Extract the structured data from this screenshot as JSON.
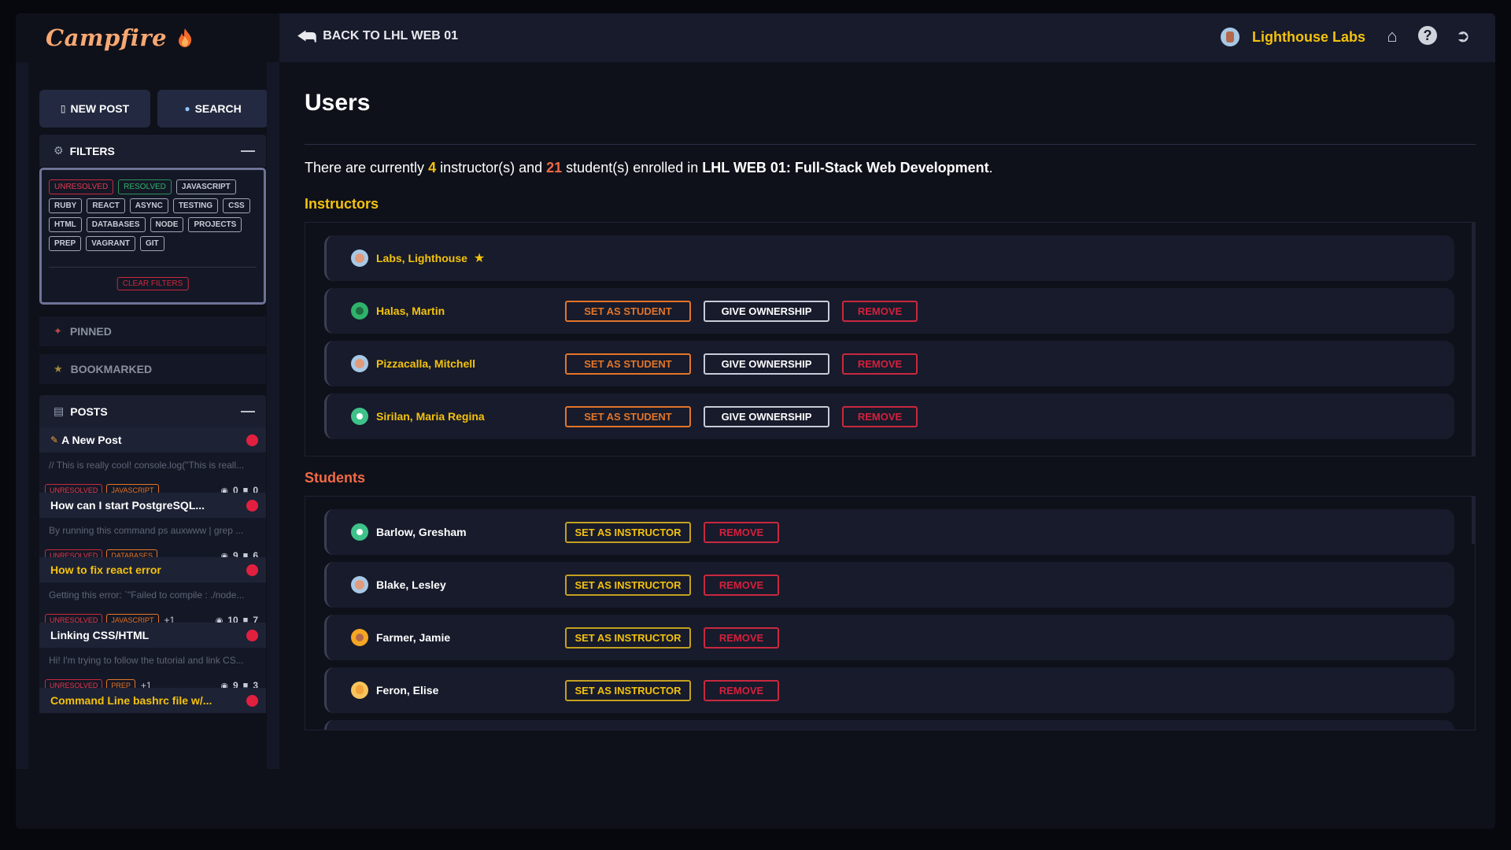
{
  "app": {
    "name": "Campfire"
  },
  "sidebar": {
    "new_post_label": "NEW POST",
    "search_label": "SEARCH",
    "filters_title": "FILTERS",
    "filter_tags": [
      {
        "label": "UNRESOLVED",
        "style": "red"
      },
      {
        "label": "RESOLVED",
        "style": "green"
      },
      {
        "label": "JAVASCRIPT",
        "style": "plain"
      },
      {
        "label": "RUBY",
        "style": "plain"
      },
      {
        "label": "REACT",
        "style": "plain"
      },
      {
        "label": "ASYNC",
        "style": "plain"
      },
      {
        "label": "TESTING",
        "style": "plain"
      },
      {
        "label": "CSS",
        "style": "plain"
      },
      {
        "label": "HTML",
        "style": "plain"
      },
      {
        "label": "DATABASES",
        "style": "plain"
      },
      {
        "label": "NODE",
        "style": "plain"
      },
      {
        "label": "PROJECTS",
        "style": "plain"
      },
      {
        "label": "PREP",
        "style": "plain"
      },
      {
        "label": "VAGRANT",
        "style": "plain"
      },
      {
        "label": "GIT",
        "style": "plain"
      }
    ],
    "clear_filters_label": "CLEAR FILTERS",
    "pinned_label": "PINNED",
    "bookmarked_label": "BOOKMARKED",
    "posts_title": "POSTS",
    "posts": [
      {
        "title": "A New Post",
        "title_color": "white",
        "preview": "// This is really cool! console.log(\"This is reall...",
        "tags": [
          "UNRESOLVED",
          "JAVASCRIPT"
        ],
        "more": "",
        "views": "0",
        "comments": "0",
        "pencil": true
      },
      {
        "title": "How can I start PostgreSQL...",
        "title_color": "white",
        "preview": "By running this command ps auxwww | grep ...",
        "tags": [
          "UNRESOLVED",
          "DATABASES"
        ],
        "more": "",
        "views": "9",
        "comments": "6",
        "pencil": false
      },
      {
        "title": "How to fix react error",
        "title_color": "yellow",
        "preview": "Getting this error: `\"Failed to compile : ./node...",
        "tags": [
          "UNRESOLVED",
          "JAVASCRIPT"
        ],
        "more": "+1",
        "views": "10",
        "comments": "7",
        "pencil": false
      },
      {
        "title": "Linking CSS/HTML",
        "title_color": "white",
        "preview": "Hi! I'm trying to follow the tutorial and link CS...",
        "tags": [
          "UNRESOLVED",
          "PREP"
        ],
        "more": "+1",
        "views": "9",
        "comments": "3",
        "pencil": false
      },
      {
        "title": "Command Line bashrc file w/...",
        "title_color": "yellow",
        "preview": "",
        "tags": [],
        "more": "",
        "views": "",
        "comments": "",
        "pencil": false
      }
    ]
  },
  "topbar": {
    "back_label": "BACK TO LHL WEB 01",
    "org_name": "Lighthouse Labs",
    "icons": [
      "home-icon",
      "help-icon",
      "logout-icon"
    ]
  },
  "main": {
    "title": "Users",
    "summary": {
      "pre": "There are currently ",
      "instructor_count": "4",
      "mid1": " instructor(s) and ",
      "student_count": "21",
      "mid2": " student(s) enrolled in ",
      "course": "LHL WEB 01: Full-Stack Web Development",
      "end": "."
    },
    "instructors_title": "Instructors",
    "students_title": "Students",
    "instructors": [
      {
        "name": "Labs, Lighthouse",
        "owner": true,
        "avatar": "blue"
      },
      {
        "name": "Halas, Martin",
        "owner": false,
        "avatar": "green"
      },
      {
        "name": "Pizzacalla, Mitchell",
        "owner": false,
        "avatar": "blue"
      },
      {
        "name": "Sirilan, Maria Regina",
        "owner": false,
        "avatar": "teal"
      }
    ],
    "students": [
      {
        "name": "Barlow, Gresham",
        "avatar": "teal"
      },
      {
        "name": "Blake, Lesley",
        "avatar": "blue"
      },
      {
        "name": "Farmer, Jamie",
        "avatar": "orange"
      },
      {
        "name": "Feron, Elise",
        "avatar": "peach"
      }
    ],
    "buttons": {
      "set_student": "SET AS STUDENT",
      "give_ownership": "GIVE OWNERSHIP",
      "remove": "REMOVE",
      "set_instructor": "SET AS INSTRUCTOR"
    }
  },
  "colors": {
    "accent_yellow": "#f4c20d",
    "accent_orange": "#f26a45",
    "danger_red": "#c9283f",
    "background": "#0f111a"
  }
}
